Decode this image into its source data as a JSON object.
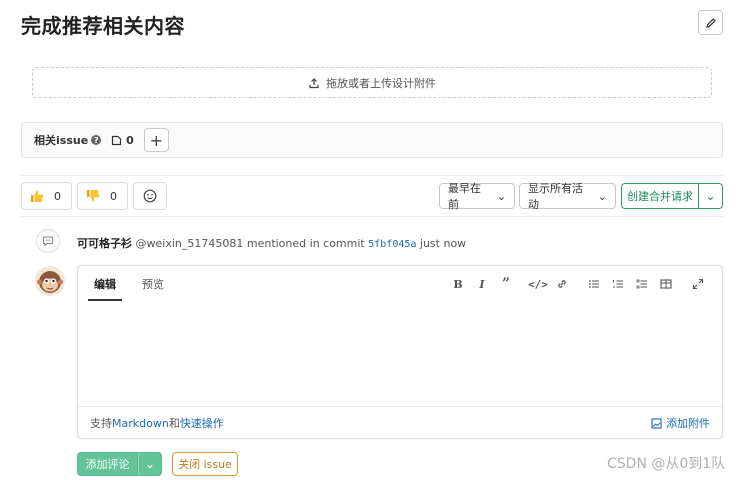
{
  "page": {
    "title": "完成推荐相关内容"
  },
  "design_upload": {
    "text": "拖放或者上传设计附件"
  },
  "related_issues": {
    "label": "相关issue",
    "help_glyph": "?",
    "count": "0"
  },
  "awards": {
    "thumbs_up_count": "0",
    "thumbs_down_count": "0"
  },
  "activity": {
    "sort_label": "最早在前",
    "filter_label": "显示所有活动",
    "create_mr_label": "创建合并请求"
  },
  "system_note": {
    "author": "可可格子衫",
    "username": "@weixin_51745081",
    "action": "mentioned in commit",
    "commit": "5fbf045a",
    "time": "just now"
  },
  "editor": {
    "tab_write": "编辑",
    "tab_preview": "预览",
    "footer_prefix": "支持",
    "markdown_link": "Markdown",
    "footer_and": "和",
    "quick_actions_link": "快速操作",
    "attach_label": "添加附件"
  },
  "actions": {
    "submit_label": "添加评论",
    "close_label": "关闭 issue"
  },
  "watermark": "CSDN @从0到1队",
  "colors": {
    "primary_green": "#63c39a",
    "link_blue": "#1b69b6",
    "warning_orange": "#c07a1a"
  }
}
